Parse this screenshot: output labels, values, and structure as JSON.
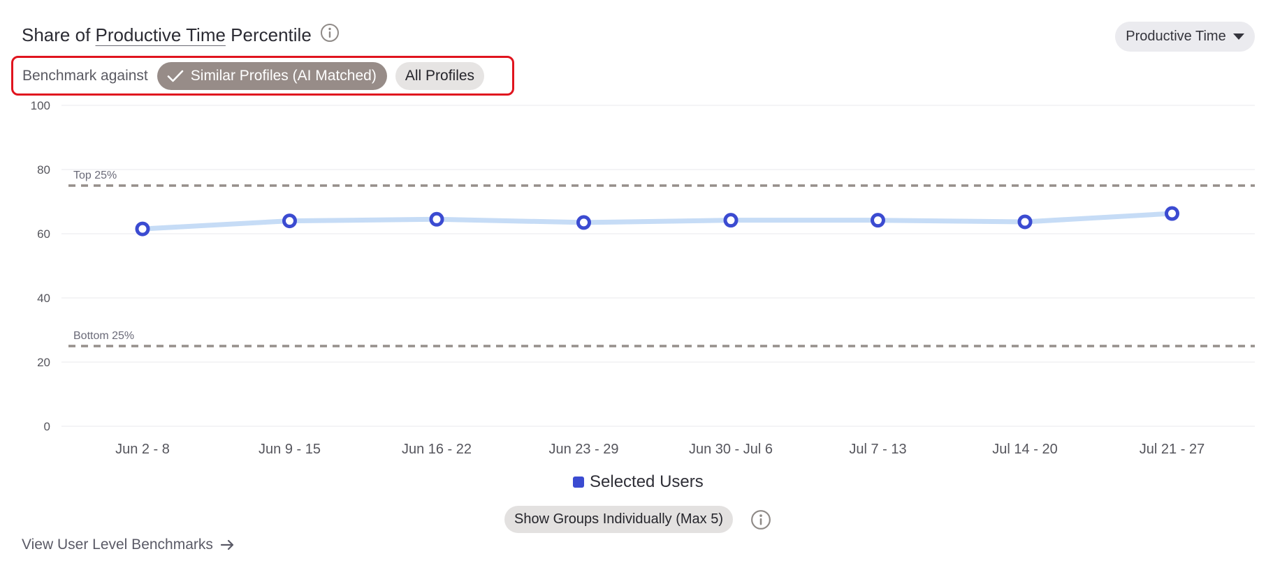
{
  "header": {
    "title_prefix": "Share of",
    "title_link": "Productive Time",
    "title_suffix": "Percentile",
    "metric_selector": "Productive Time"
  },
  "benchmark": {
    "label": "Benchmark against",
    "options": [
      "Similar Profiles (AI Matched)",
      "All Profiles"
    ],
    "selected": "Similar Profiles (AI Matched)"
  },
  "chart_data": {
    "type": "line",
    "categories": [
      "Jun 2 - 8",
      "Jun 9 - 15",
      "Jun 16 - 22",
      "Jun 23 - 29",
      "Jun 30 - Jul 6",
      "Jul 7 - 13",
      "Jul 14 - 20",
      "Jul 21 - 27"
    ],
    "series": [
      {
        "name": "Selected Users",
        "values": [
          61.5,
          64,
          64.5,
          63.5,
          64.2,
          64.2,
          63.7,
          66.3
        ],
        "color": "#3b4bd1",
        "line_color": "#c6dcf6"
      }
    ],
    "yticks": [
      0,
      20,
      40,
      60,
      80,
      100
    ],
    "ylim": [
      0,
      100
    ],
    "grid": true,
    "reference_lines": [
      {
        "label": "Top 25%",
        "value": 75,
        "color": "#968f8b"
      },
      {
        "label": "Bottom 25%",
        "value": 25,
        "color": "#968f8b"
      }
    ],
    "legend_position": "bottom"
  },
  "footer": {
    "groups_button": "Show Groups Individually (Max 5)",
    "view_link": "View User Level Benchmarks"
  },
  "colors": {
    "accent": "#3b4bd1",
    "chip_active": "#978c88",
    "highlight": "#e0141e"
  }
}
